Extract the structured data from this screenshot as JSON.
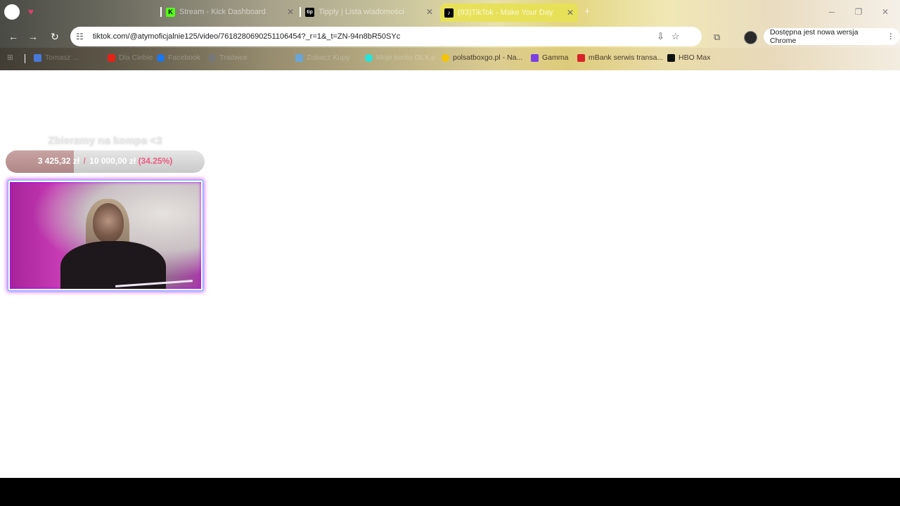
{
  "tabs": [
    {
      "label": "Stream - Kick Dashboard",
      "favicon": "K",
      "favicon_color": "#53fc18"
    },
    {
      "label": "Tipply | Lista wiadomości",
      "favicon": "tip",
      "favicon_color": "#000000"
    },
    {
      "label": "(93)TikTok - Make Your Day",
      "favicon": "♪",
      "favicon_color": "#000000",
      "active": true
    }
  ],
  "address": {
    "url": "tiktok.com/@atymoficjalnie125/video/7618280690251106454?_r=1&_t=ZN-94n8bR50SYc"
  },
  "update_banner": {
    "label": "Dostępna jest nowa wersja Chrome"
  },
  "bookmarks": [
    {
      "label": "Tomasz ...",
      "icon": "folder-icon",
      "color": "#4a78d9"
    },
    {
      "label": "Dla Ciebie",
      "icon": "youtube-icon",
      "color": "#e62117"
    },
    {
      "label": "Facebook",
      "icon": "facebook-icon",
      "color": "#1877f2"
    },
    {
      "label": "Tradwce",
      "icon": "globe-icon",
      "color": "#777777"
    },
    {
      "label": "Zobacz Kupy",
      "icon": "image-icon",
      "color": "#6aa5d8"
    },
    {
      "label": "Moje konto OLX.p",
      "icon": "olx-icon",
      "color": "#23e5db"
    },
    {
      "label": "polsatboxgo.pl - Na...",
      "icon": "polsat-icon",
      "color": "#f5c400"
    },
    {
      "label": "Gamma",
      "icon": "gamma-icon",
      "color": "#7b3fe4"
    },
    {
      "label": "mBank serwis transa...",
      "icon": "mbank-icon",
      "color": "#d8232a"
    },
    {
      "label": "HBO Max",
      "icon": "hbo-icon",
      "color": "#111111"
    }
  ],
  "goal": {
    "title": "Zbieramy na kompa <3",
    "current": "3 425,32 zł",
    "separator": "/",
    "target": "10 000,00 zł",
    "percent_label": "(34.25%)",
    "progress": 0.3425
  },
  "colors": {
    "accent_pink": "#ec5a80",
    "frame_cyan": "#58c8ff",
    "frame_magenta": "#d14fff"
  }
}
